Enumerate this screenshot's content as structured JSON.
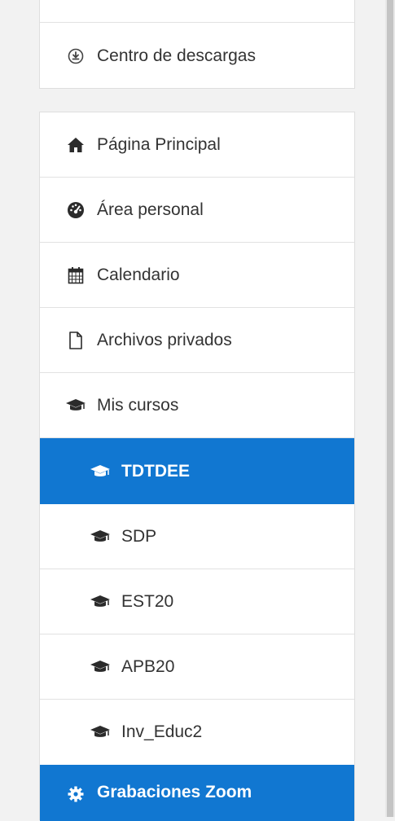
{
  "top_card": {
    "downloads": {
      "label": "Centro de descargas",
      "icon": "download-circle-icon"
    }
  },
  "nav": {
    "items": [
      {
        "label": "Página Principal",
        "icon": "home-icon"
      },
      {
        "label": "Área personal",
        "icon": "dashboard-icon"
      },
      {
        "label": "Calendario",
        "icon": "calendar-icon"
      },
      {
        "label": "Archivos privados",
        "icon": "file-icon"
      },
      {
        "label": "Mis cursos",
        "icon": "graduation-cap-icon"
      }
    ],
    "courses": [
      {
        "label": "TDTDEE",
        "active": true
      },
      {
        "label": "SDP"
      },
      {
        "label": "EST20"
      },
      {
        "label": "APB20"
      },
      {
        "label": "Inv_Educ2"
      }
    ],
    "zoom": {
      "label": "Grabaciones Zoom",
      "icon": "gear-icon",
      "active": true
    }
  },
  "colors": {
    "active_bg": "#1177d1",
    "text": "#333333"
  }
}
